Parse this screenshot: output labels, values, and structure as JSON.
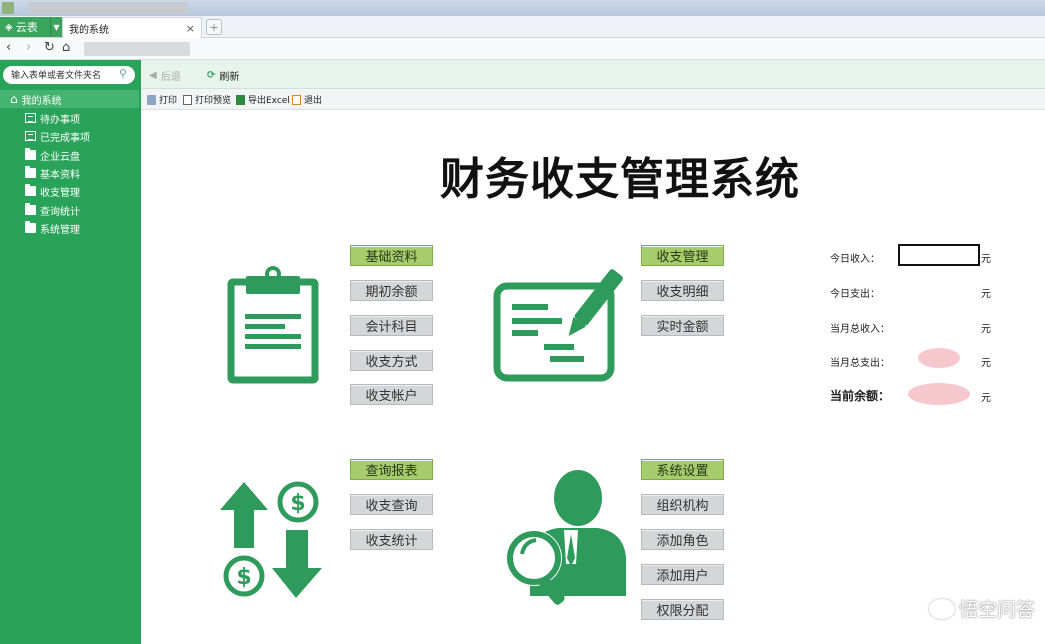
{
  "tabs": {
    "app_label": "云表",
    "page_label": "我的系统",
    "close_glyph": "×",
    "new_tab_glyph": "+"
  },
  "sidebar": {
    "search_placeholder": "输入表单或者文件夹名",
    "root_label": "我的系统",
    "items": [
      {
        "label": "待办事项",
        "icon": "document-icon"
      },
      {
        "label": "已完成事项",
        "icon": "document-icon"
      },
      {
        "label": "企业云盘",
        "icon": "folder-icon"
      },
      {
        "label": "基本资料",
        "icon": "folder-icon"
      },
      {
        "label": "收支管理",
        "icon": "folder-icon"
      },
      {
        "label": "查询统计",
        "icon": "folder-icon"
      },
      {
        "label": "系统管理",
        "icon": "folder-icon"
      }
    ]
  },
  "toolbar": {
    "back_label": "后退",
    "refresh_label": "刷新",
    "print_label": "打印",
    "preview_label": "打印预览",
    "excel_label": "导出Excel",
    "exit_label": "退出"
  },
  "main": {
    "title": "财务收支管理系统",
    "groups": {
      "basic": [
        "基础资料",
        "期初余额",
        "会计科目",
        "收支方式",
        "收支帐户"
      ],
      "income": [
        "收支管理",
        "收支明细",
        "实时金额"
      ],
      "report": [
        "查询报表",
        "收支查询",
        "收支统计"
      ],
      "system": [
        "系统设置",
        "组织机构",
        "添加角色",
        "添加用户",
        "权限分配"
      ]
    },
    "stats": {
      "today_income_label": "今日收入：",
      "today_expense_label": "今日支出：",
      "month_income_label": "当月总收入：",
      "month_expense_label": "当月总支出：",
      "balance_label": "当前余额：",
      "unit": "元"
    }
  },
  "colors": {
    "brand_green": "#2aa35a",
    "icon_green": "#2e9a5b",
    "active_button": "#a6cc6c"
  },
  "watermark": "悟空问答"
}
